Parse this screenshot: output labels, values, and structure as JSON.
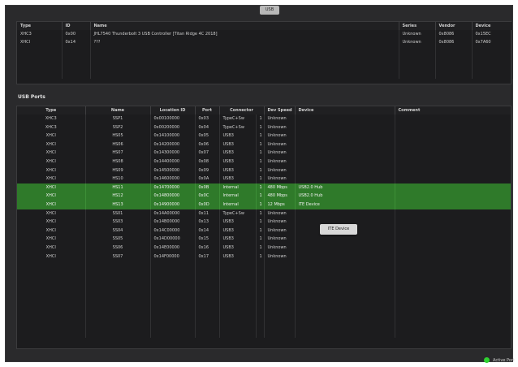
{
  "top_tab": {
    "label": "USB"
  },
  "controllers": {
    "columns": [
      "Type",
      "ID",
      "Name",
      "Series",
      "Vendor",
      "Device"
    ],
    "rows": [
      {
        "type": "XHC3",
        "id": "0x00",
        "name": "JHL7540 Thunderbolt 3 USB Controller [Titan Ridge 4C 2018]",
        "series": "Unknown",
        "vendor": "0x8086",
        "device": "0x15EC"
      },
      {
        "type": "XHCI",
        "id": "0x14",
        "name": "???",
        "series": "Unknown",
        "vendor": "0x8086",
        "device": "0x7A60"
      }
    ]
  },
  "ports_section": {
    "title": "USB Ports"
  },
  "ports": {
    "columns": [
      "Type",
      "Name",
      "Location ID",
      "Port",
      "Connector",
      "Dev Speed",
      "Device",
      "Comment"
    ],
    "rows": [
      {
        "type": "XHC3",
        "name": "SSP1",
        "location": "0x00100000",
        "port": "0x03",
        "connector": "TypeC+Sw",
        "flag": "1",
        "speed": "Unknown",
        "device": "",
        "comment": "",
        "selected": false
      },
      {
        "type": "XHC3",
        "name": "SSP2",
        "location": "0x00200000",
        "port": "0x04",
        "connector": "TypeC+Sw",
        "flag": "1",
        "speed": "Unknown",
        "device": "",
        "comment": "",
        "selected": false
      },
      {
        "type": "XHCI",
        "name": "HS05",
        "location": "0x14100000",
        "port": "0x05",
        "connector": "USB3",
        "flag": "1",
        "speed": "Unknown",
        "device": "",
        "comment": "",
        "selected": false
      },
      {
        "type": "XHCI",
        "name": "HS06",
        "location": "0x14200000",
        "port": "0x06",
        "connector": "USB3",
        "flag": "1",
        "speed": "Unknown",
        "device": "",
        "comment": "",
        "selected": false
      },
      {
        "type": "XHCI",
        "name": "HS07",
        "location": "0x14300000",
        "port": "0x07",
        "connector": "USB3",
        "flag": "1",
        "speed": "Unknown",
        "device": "",
        "comment": "",
        "selected": false
      },
      {
        "type": "XHCI",
        "name": "HS08",
        "location": "0x14400000",
        "port": "0x08",
        "connector": "USB3",
        "flag": "1",
        "speed": "Unknown",
        "device": "",
        "comment": "",
        "selected": false
      },
      {
        "type": "XHCI",
        "name": "HS09",
        "location": "0x14500000",
        "port": "0x09",
        "connector": "USB3",
        "flag": "1",
        "speed": "Unknown",
        "device": "",
        "comment": "",
        "selected": false
      },
      {
        "type": "XHCI",
        "name": "HS10",
        "location": "0x14600000",
        "port": "0x0A",
        "connector": "USB3",
        "flag": "1",
        "speed": "Unknown",
        "device": "",
        "comment": "",
        "selected": false
      },
      {
        "type": "XHCI",
        "name": "HS11",
        "location": "0x14700000",
        "port": "0x0B",
        "connector": "Internal",
        "flag": "1",
        "speed": "480 Mbps",
        "device": "USB2.0 Hub",
        "comment": "",
        "selected": true
      },
      {
        "type": "XHCI",
        "name": "HS12",
        "location": "0x14800000",
        "port": "0x0C",
        "connector": "Internal",
        "flag": "1",
        "speed": "480 Mbps",
        "device": "USB2.0 Hub",
        "comment": "",
        "selected": true
      },
      {
        "type": "XHCI",
        "name": "HS13",
        "location": "0x14900000",
        "port": "0x0D",
        "connector": "Internal",
        "flag": "1",
        "speed": "12 Mbps",
        "device": "ITE Device",
        "comment": "",
        "selected": true
      },
      {
        "type": "XHCI",
        "name": "SS01",
        "location": "0x14A00000",
        "port": "0x11",
        "connector": "TypeC+Sw",
        "flag": "1",
        "speed": "Unknown",
        "device": "",
        "comment": "",
        "selected": false
      },
      {
        "type": "XHCI",
        "name": "SS03",
        "location": "0x14B00000",
        "port": "0x13",
        "connector": "USB3",
        "flag": "1",
        "speed": "Unknown",
        "device": "",
        "comment": "",
        "selected": false
      },
      {
        "type": "XHCI",
        "name": "SS04",
        "location": "0x14C00000",
        "port": "0x14",
        "connector": "USB3",
        "flag": "1",
        "speed": "Unknown",
        "device": "",
        "comment": "",
        "selected": false
      },
      {
        "type": "XHCI",
        "name": "SS05",
        "location": "0x14D00000",
        "port": "0x15",
        "connector": "USB3",
        "flag": "1",
        "speed": "Unknown",
        "device": "",
        "comment": "",
        "selected": false
      },
      {
        "type": "XHCI",
        "name": "SS06",
        "location": "0x14E00000",
        "port": "0x16",
        "connector": "USB3",
        "flag": "1",
        "speed": "Unknown",
        "device": "",
        "comment": "",
        "selected": false
      },
      {
        "type": "XHCI",
        "name": "SS07",
        "location": "0x14F00000",
        "port": "0x17",
        "connector": "USB3",
        "flag": "1",
        "speed": "Unknown",
        "device": "",
        "comment": "",
        "selected": false
      }
    ]
  },
  "tooltip": {
    "text": "ITE Device"
  },
  "status": {
    "label": "Active Port",
    "color": "#2fd130"
  },
  "colors": {
    "selection": "#2f7a2a",
    "panel": "#1c1c1e",
    "window": "#2a2a2c"
  }
}
